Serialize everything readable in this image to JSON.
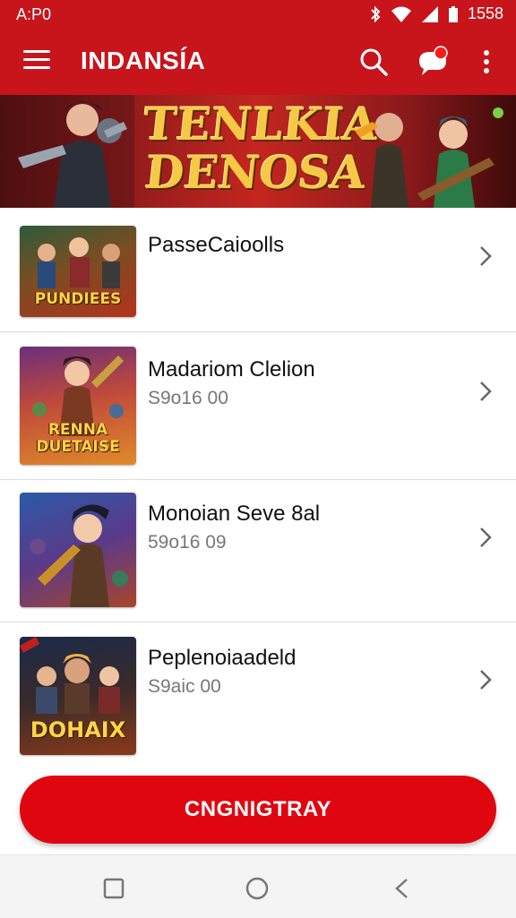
{
  "status_bar": {
    "time_left": "A:P0",
    "clock": "1558"
  },
  "app_bar": {
    "title": "INDANSÍA",
    "menu_icon": "hamburger-menu-icon",
    "search_icon": "search-icon",
    "notification_icon": "chat-bubble-icon",
    "more_icon": "more-vert-icon"
  },
  "banner": {
    "line1": "TENLKIA",
    "line2": "DENOSA"
  },
  "list": {
    "items": [
      {
        "title": "PasseCaioolls",
        "subtitle": "",
        "thumb_text": "PUNDIEES"
      },
      {
        "title": "Madariom Clelion",
        "subtitle": "S9o16 00",
        "thumb_text": "RENNA DUETAISE"
      },
      {
        "title": "Monoian Seve 8al",
        "subtitle": "59o16 09",
        "thumb_text": ""
      },
      {
        "title": "Peplenoiaadeld",
        "subtitle": "S9aic 00",
        "thumb_text": "DOHAIX"
      }
    ]
  },
  "cta": {
    "label": "CNGNIGTRAY"
  },
  "colors": {
    "primary": "#c8141b",
    "cta": "#e0060f",
    "badge": "#ff1a1a"
  }
}
